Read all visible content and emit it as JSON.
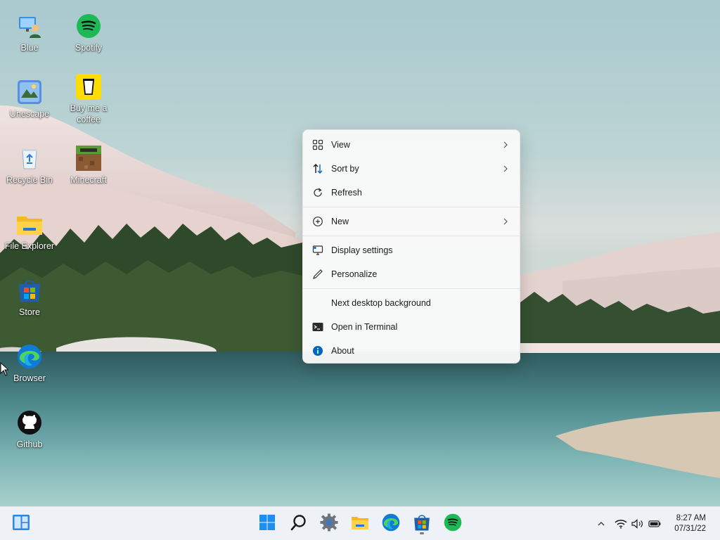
{
  "desktop": {
    "icons": [
      {
        "label": "Blue",
        "icon": "user-monitor-icon"
      },
      {
        "label": "Spotify",
        "icon": "spotify-icon"
      },
      {
        "label": "Unescape",
        "icon": "unescape-icon"
      },
      {
        "label": "Buy me a coffee",
        "icon": "coffee-cup-icon"
      },
      {
        "label": "Recycle Bin",
        "icon": "recycle-bin-icon"
      },
      {
        "label": "Minecraft",
        "icon": "minecraft-icon"
      },
      {
        "label": "File Explorer",
        "icon": "folder-icon"
      },
      {
        "label": "Store",
        "icon": "store-icon"
      },
      {
        "label": "Browser",
        "icon": "edge-icon"
      },
      {
        "label": "Github",
        "icon": "github-icon"
      }
    ]
  },
  "context_menu": {
    "items": [
      {
        "label": "View",
        "icon": "grid-icon",
        "submenu": true
      },
      {
        "label": "Sort by",
        "icon": "sort-icon",
        "submenu": true
      },
      {
        "label": "Refresh",
        "icon": "refresh-icon",
        "submenu": false
      },
      {
        "label": "New",
        "icon": "plus-circle-icon",
        "submenu": true
      },
      {
        "label": "Display settings",
        "icon": "display-icon",
        "submenu": false
      },
      {
        "label": "Personalize",
        "icon": "pen-icon",
        "submenu": false
      },
      {
        "label": "Next desktop background",
        "icon": "",
        "submenu": false
      },
      {
        "label": "Open in Terminal",
        "icon": "terminal-icon",
        "submenu": false
      },
      {
        "label": "About",
        "icon": "info-icon",
        "submenu": false
      }
    ]
  },
  "taskbar": {
    "apps": [
      "widgets-icon",
      "start-icon",
      "search-icon",
      "settings-icon",
      "file-explorer-icon",
      "edge-icon",
      "store-icon",
      "spotify-icon"
    ],
    "tray": [
      "chevron-up-icon",
      "wifi-icon",
      "volume-icon",
      "battery-icon"
    ],
    "time": "8:27 AM",
    "date": "07/31/22"
  },
  "colors": {
    "accent": "#0067c0",
    "spotify": "#1db954",
    "taskbar_bg": "#eef2f6",
    "menu_bg": "#f9f9f9"
  }
}
